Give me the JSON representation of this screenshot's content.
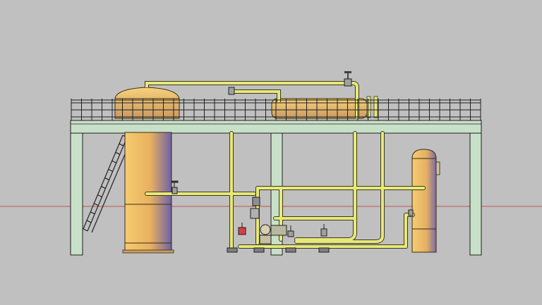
{
  "scene": {
    "description_hidden": "",
    "colors": {
      "background": "#c0c0c0",
      "steel": "#c8e0c8",
      "steel_edge": "#2a2a2a",
      "tank_light": "#f4c86c",
      "tank_dark": "#7a6aa8",
      "pipe": "#e8e87a",
      "pipe_edge": "#3a3a20",
      "axis_line": "#c02020"
    }
  }
}
